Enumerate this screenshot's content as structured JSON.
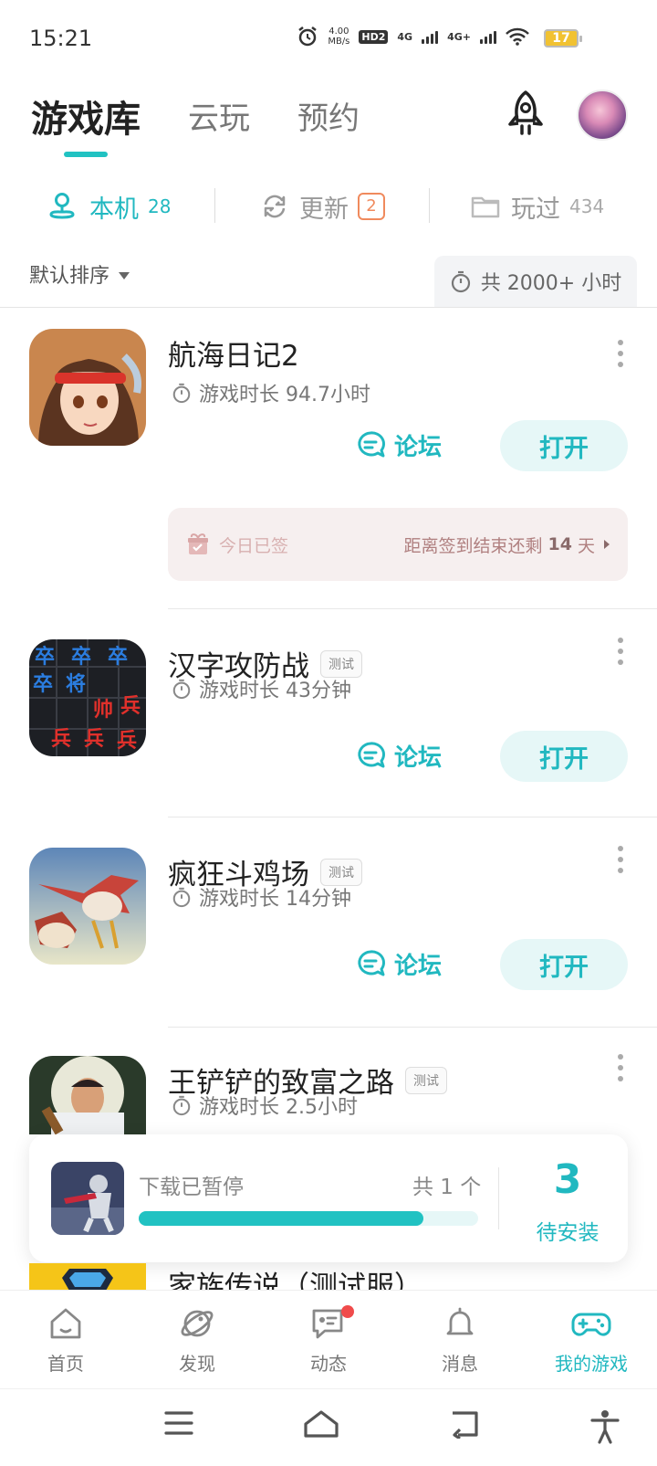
{
  "status": {
    "time": "15:21",
    "speed_value": "4.00",
    "speed_unit": "MB/s",
    "hd": "HD2",
    "net1": "4G",
    "net2": "4G+",
    "battery": "17"
  },
  "top_tabs": [
    {
      "label": "游戏库",
      "active": true
    },
    {
      "label": "云玩",
      "active": false
    },
    {
      "label": "预约",
      "active": false
    }
  ],
  "segments": {
    "local": {
      "label": "本机",
      "count": "28"
    },
    "update": {
      "label": "更新",
      "count": "2"
    },
    "played": {
      "label": "玩过",
      "count": "434"
    }
  },
  "sort_label": "默认排序",
  "total_time": "共 2000+ 小时",
  "games": [
    {
      "title": "航海日记2",
      "tag": "",
      "playtime": "游戏时长 94.7小时",
      "forum": "论坛",
      "open": "打开"
    },
    {
      "title": "汉字攻防战",
      "tag": "测试",
      "playtime": "游戏时长 43分钟",
      "forum": "论坛",
      "open": "打开"
    },
    {
      "title": "疯狂斗鸡场",
      "tag": "测试",
      "playtime": "游戏时长 14分钟",
      "forum": "论坛",
      "open": "打开"
    },
    {
      "title": "王铲铲的致富之路",
      "tag": "测试",
      "playtime": "游戏时长 2.5小时"
    },
    {
      "title": "家族传说（测试服）"
    }
  ],
  "signin": {
    "left": "今日已签",
    "right_prefix": "距离签到结束还剩",
    "days": "14",
    "right_suffix": "天"
  },
  "download": {
    "status": "下载已暂停",
    "count": "共 1 个",
    "progress": 0.84,
    "pending_count": "3",
    "pending_label": "待安装"
  },
  "bottom_nav": [
    {
      "label": "首页",
      "icon": "home-icon",
      "active": false
    },
    {
      "label": "发现",
      "icon": "discover-icon",
      "active": false
    },
    {
      "label": "动态",
      "icon": "feed-icon",
      "active": false,
      "badge": true
    },
    {
      "label": "消息",
      "icon": "bell-icon",
      "active": false
    },
    {
      "label": "我的游戏",
      "icon": "gamepad-icon",
      "active": true
    }
  ],
  "colors": {
    "accent": "#21b8c0",
    "badge": "#f08a5d",
    "dot": "#f04b4b"
  }
}
